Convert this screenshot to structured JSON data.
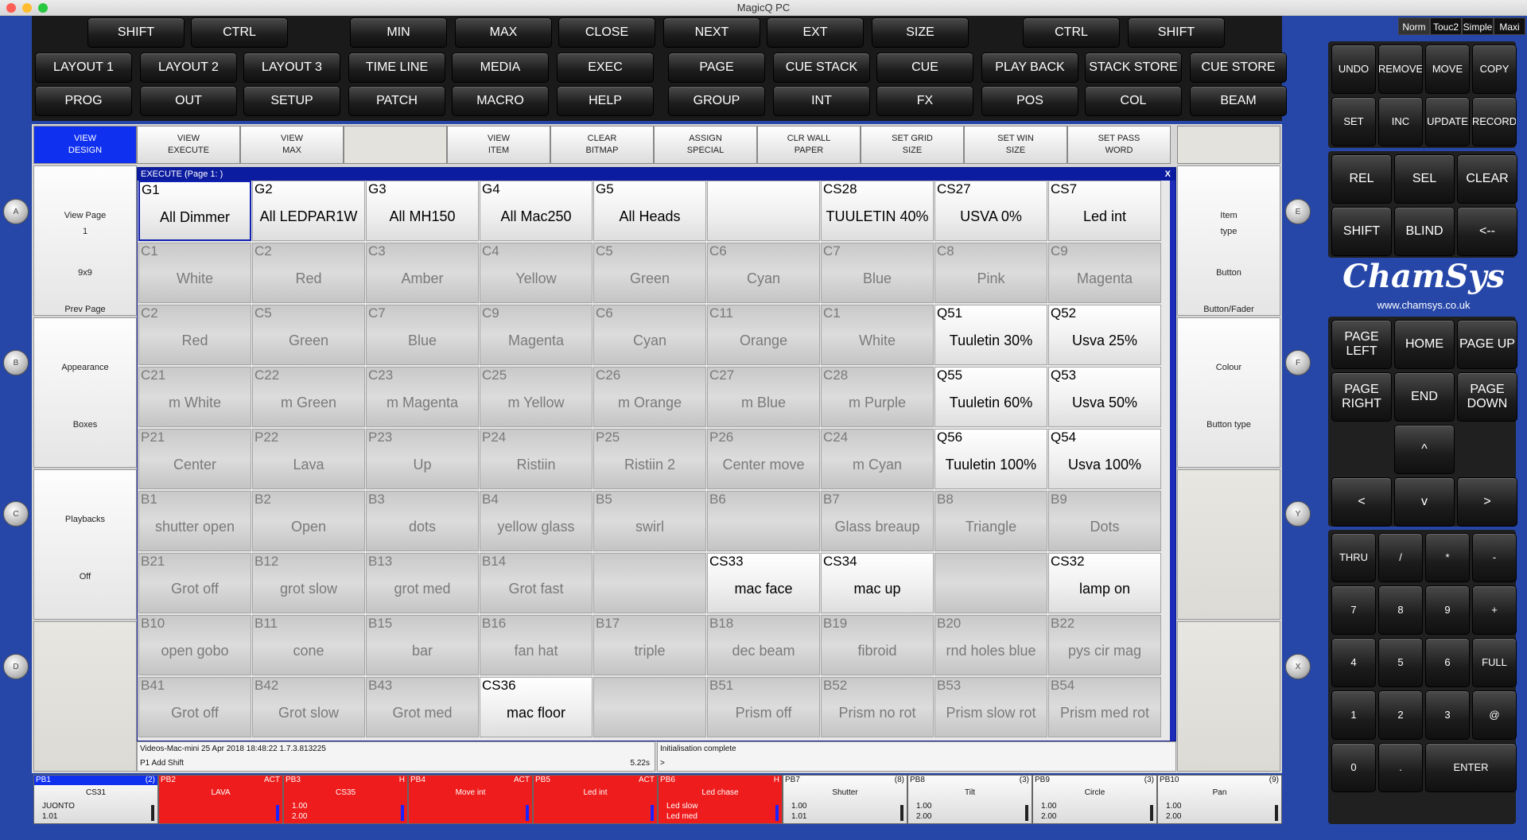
{
  "app_title": "MagicQ PC",
  "window_controls": {
    "close": "#fd5f57",
    "minimize": "#febc2e",
    "zoom": "#28c840"
  },
  "modes": [
    "Norm",
    "Touc2",
    "Simple",
    "Maxi"
  ],
  "top_row": [
    "SHIFT",
    "CTRL",
    "MIN",
    "MAX",
    "CLOSE",
    "NEXT",
    "EXT",
    "SIZE",
    "CTRL",
    "SHIFT"
  ],
  "window_row1": [
    "LAYOUT 1",
    "LAYOUT 2",
    "LAYOUT 3",
    "TIME LINE",
    "MEDIA",
    "EXEC"
  ],
  "window_row2": [
    "PROG",
    "OUT",
    "SETUP",
    "PATCH",
    "MACRO",
    "HELP"
  ],
  "stack_row1": [
    "PAGE",
    "CUE STACK",
    "CUE",
    "PLAY BACK",
    "STACK STORE",
    "CUE STORE"
  ],
  "stack_row2": [
    "GROUP",
    "INT",
    "FX",
    "POS",
    "COL",
    "BEAM"
  ],
  "view_buttons": [
    {
      "l1": "VIEW",
      "l2": "DESIGN"
    },
    {
      "l1": "VIEW",
      "l2": "EXECUTE"
    },
    {
      "l1": "VIEW",
      "l2": "MAX"
    },
    {
      "l1": "",
      "l2": ""
    },
    {
      "l1": "VIEW",
      "l2": "ITEM"
    },
    {
      "l1": "CLEAR",
      "l2": "BITMAP"
    },
    {
      "l1": "ASSIGN",
      "l2": "SPECIAL"
    },
    {
      "l1": "CLR WALL",
      "l2": "PAPER"
    },
    {
      "l1": "SET GRID",
      "l2": "SIZE"
    },
    {
      "l1": "SET WIN",
      "l2": "SIZE"
    },
    {
      "l1": "SET PASS",
      "l2": "WORD"
    }
  ],
  "left_soft": [
    {
      "a": "View Page",
      "b": "1",
      "c": "9x9",
      "d": "Prev Page"
    },
    {
      "a": "Appearance",
      "b": "",
      "c": "Boxes",
      "d": ""
    },
    {
      "a": "Playbacks",
      "b": "",
      "c": "Off",
      "d": ""
    },
    {
      "a": "",
      "b": "",
      "c": "",
      "d": ""
    }
  ],
  "right_soft": [
    {
      "a": "Item",
      "b": "type",
      "c": "Button",
      "d": "Button/Fader"
    },
    {
      "a": "Colour",
      "b": "",
      "c": "Button type",
      "d": ""
    },
    {
      "a": "",
      "b": "",
      "c": "",
      "d": ""
    },
    {
      "a": "",
      "b": "",
      "c": "",
      "d": ""
    }
  ],
  "knobs_left": [
    "A",
    "B",
    "C",
    "D"
  ],
  "knobs_right": [
    "E",
    "F",
    "Y",
    "X"
  ],
  "execute": {
    "title": "EXECUTE (Page 1: )",
    "close": "X",
    "rows": [
      [
        [
          "G1",
          "All Dimmer",
          1
        ],
        [
          "G2",
          "All LEDPAR1W",
          1
        ],
        [
          "G3",
          "All MH150",
          1
        ],
        [
          "G4",
          "All Mac250",
          1
        ],
        [
          "G5",
          "All Heads",
          1
        ],
        [
          "",
          "",
          1
        ],
        [
          "CS28",
          "TUULETIN 40%",
          1
        ],
        [
          "CS27",
          "USVA 0%",
          1
        ],
        [
          "CS7",
          "Led int",
          1
        ]
      ],
      [
        [
          "C1",
          "White",
          0
        ],
        [
          "C2",
          "Red",
          0
        ],
        [
          "C3",
          "Amber",
          0
        ],
        [
          "C4",
          "Yellow",
          0
        ],
        [
          "C5",
          "Green",
          0
        ],
        [
          "C6",
          "Cyan",
          0
        ],
        [
          "C7",
          "Blue",
          0
        ],
        [
          "C8",
          "Pink",
          0
        ],
        [
          "C9",
          "Magenta",
          0
        ]
      ],
      [
        [
          "C2",
          "Red",
          0
        ],
        [
          "C5",
          "Green",
          0
        ],
        [
          "C7",
          "Blue",
          0
        ],
        [
          "C9",
          "Magenta",
          0
        ],
        [
          "C6",
          "Cyan",
          0
        ],
        [
          "C11",
          "Orange",
          0
        ],
        [
          "C1",
          "White",
          0
        ],
        [
          "Q51",
          "Tuuletin 30%",
          1
        ],
        [
          "Q52",
          "Usva 25%",
          1
        ]
      ],
      [
        [
          "C21",
          "m White",
          0
        ],
        [
          "C22",
          "m Green",
          0
        ],
        [
          "C23",
          "m Magenta",
          0
        ],
        [
          "C25",
          "m Yellow",
          0
        ],
        [
          "C26",
          "m Orange",
          0
        ],
        [
          "C27",
          "m Blue",
          0
        ],
        [
          "C28",
          "m Purple",
          0
        ],
        [
          "Q55",
          "Tuuletin 60%",
          1
        ],
        [
          "Q53",
          "Usva 50%",
          1
        ]
      ],
      [
        [
          "P21",
          "Center",
          0
        ],
        [
          "P22",
          "Lava",
          0
        ],
        [
          "P23",
          "Up",
          0
        ],
        [
          "P24",
          "Ristiin",
          0
        ],
        [
          "P25",
          "Ristiin 2",
          0
        ],
        [
          "P26",
          "Center move",
          0
        ],
        [
          "C24",
          "m Cyan",
          0
        ],
        [
          "Q56",
          "Tuuletin 100%",
          1
        ],
        [
          "Q54",
          "Usva 100%",
          1
        ]
      ],
      [
        [
          "B1",
          "shutter open",
          0
        ],
        [
          "B2",
          "Open",
          0
        ],
        [
          "B3",
          "dots",
          0
        ],
        [
          "B4",
          "yellow glass",
          0
        ],
        [
          "B5",
          "swirl",
          0
        ],
        [
          "B6",
          "",
          0
        ],
        [
          "B7",
          "Glass breaup",
          0
        ],
        [
          "B8",
          "Triangle",
          0
        ],
        [
          "B9",
          "Dots",
          0
        ]
      ],
      [
        [
          "B21",
          "Grot off",
          0
        ],
        [
          "B12",
          "grot slow",
          0
        ],
        [
          "B13",
          "grot med",
          0
        ],
        [
          "B14",
          "Grot fast",
          0
        ],
        [
          "",
          "",
          0
        ],
        [
          "CS33",
          "mac face",
          1
        ],
        [
          "CS34",
          "mac up",
          1
        ],
        [
          "",
          "",
          0
        ],
        [
          "CS32",
          "lamp on",
          1
        ]
      ],
      [
        [
          "B10",
          "open gobo",
          0
        ],
        [
          "B11",
          "cone",
          0
        ],
        [
          "B15",
          "bar",
          0
        ],
        [
          "B16",
          "fan hat",
          0
        ],
        [
          "B17",
          "triple",
          0
        ],
        [
          "B18",
          "dec beam",
          0
        ],
        [
          "B19",
          "fibroid",
          0
        ],
        [
          "B20",
          "rnd holes blue",
          0
        ],
        [
          "B22",
          "pys cir mag",
          0
        ]
      ],
      [
        [
          "B41",
          "Grot off",
          0
        ],
        [
          "B42",
          "Grot slow",
          0
        ],
        [
          "B43",
          "Grot med",
          0
        ],
        [
          "CS36",
          "mac floor",
          1
        ],
        [
          "",
          "",
          0
        ],
        [
          "B51",
          "Prism off",
          0
        ],
        [
          "B52",
          "Prism no rot",
          0
        ],
        [
          "B53",
          "Prism slow rot",
          0
        ],
        [
          "B54",
          "Prism med rot",
          0
        ]
      ]
    ]
  },
  "status": {
    "left_line1": "Videos-Mac-mini 25 Apr 2018 18:48:22 1.7.3.813225",
    "left_line2": "P1  Add Shift",
    "left_time": "5.22s",
    "right_line1": "Initialisation complete",
    "right_line2": ">"
  },
  "playbacks": [
    {
      "id": "PB1",
      "flag": "(2)",
      "name": "CS31",
      "l1": "JUONTO",
      "l2": "1.01",
      "red": false,
      "bar": "dark",
      "sel": true
    },
    {
      "id": "PB2",
      "flag": "ACT",
      "name": "LAVA",
      "l1": "",
      "l2": "",
      "red": true,
      "bar": "blue",
      "sel": false
    },
    {
      "id": "PB3",
      "flag": "H",
      "name": "CS35",
      "l1": "1.00",
      "l2": "2.00",
      "red": true,
      "bar": "blue",
      "sel": false
    },
    {
      "id": "PB4",
      "flag": "ACT",
      "name": "Move int",
      "l1": "",
      "l2": "",
      "red": true,
      "bar": "blue",
      "sel": false
    },
    {
      "id": "PB5",
      "flag": "ACT",
      "name": "Led int",
      "l1": "",
      "l2": "",
      "red": true,
      "bar": "blue",
      "sel": false
    },
    {
      "id": "PB6",
      "flag": "H",
      "name": "Led chase",
      "l1": "Led slow",
      "l2": "Led med",
      "red": true,
      "bar": "blue",
      "sel": false
    },
    {
      "id": "PB7",
      "flag": "(8)",
      "name": "Shutter",
      "l1": "1.00",
      "l2": "1.01",
      "red": false,
      "bar": "dark",
      "sel": false
    },
    {
      "id": "PB8",
      "flag": "(3)",
      "name": "Tilt",
      "l1": "1.00",
      "l2": "2.00",
      "red": false,
      "bar": "dark",
      "sel": false
    },
    {
      "id": "PB9",
      "flag": "(3)",
      "name": "Circle",
      "l1": "1.00",
      "l2": "2.00",
      "red": false,
      "bar": "dark",
      "sel": false
    },
    {
      "id": "PB10",
      "flag": "(9)",
      "name": "Pan",
      "l1": "1.00",
      "l2": "2.00",
      "red": false,
      "bar": "dark",
      "sel": false
    }
  ],
  "keypad": {
    "edit": [
      "UNDO",
      "REMOVE",
      "MOVE",
      "COPY",
      "SET",
      "INC",
      "UPDATE",
      "RECORD"
    ],
    "select": [
      "REL",
      "SEL",
      "CLEAR",
      "SHIFT",
      "BLIND",
      "<--"
    ],
    "logo": "ChamSys",
    "url": "www.chamsys.co.uk",
    "nav": [
      [
        "PAGE",
        "LEFT"
      ],
      [
        "HOME",
        ""
      ],
      [
        "PAGE UP",
        ""
      ],
      [
        "PAGE",
        "RIGHT"
      ],
      [
        "END",
        ""
      ],
      [
        "PAGE",
        "DOWN"
      ]
    ],
    "arrows": [
      "^",
      "<",
      "v",
      ">"
    ],
    "numpad": [
      "THRU",
      "/",
      "*",
      "-",
      "7",
      "8",
      "9",
      "+",
      "4",
      "5",
      "6",
      "FULL",
      "1",
      "2",
      "3",
      "@",
      "0",
      ".",
      "ENTER"
    ]
  }
}
